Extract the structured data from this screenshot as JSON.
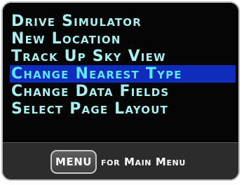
{
  "menu": {
    "items": [
      {
        "label": "Drive Simulator"
      },
      {
        "label": "New Location"
      },
      {
        "label": "Track Up Sky View"
      },
      {
        "label": "Change Nearest Type"
      },
      {
        "label": "Change Data Fields"
      },
      {
        "label": "Select Page Layout"
      }
    ],
    "selected_index": 3
  },
  "footer": {
    "key_label": "MENU",
    "hint_text": "for Main Menu"
  },
  "colors": {
    "screen_background": "#050505",
    "item_text": "#a9f0f0",
    "selected_background": "#0f2cbd",
    "selected_text": "#5ce7ff",
    "footer_background": "#2c2c2c"
  }
}
